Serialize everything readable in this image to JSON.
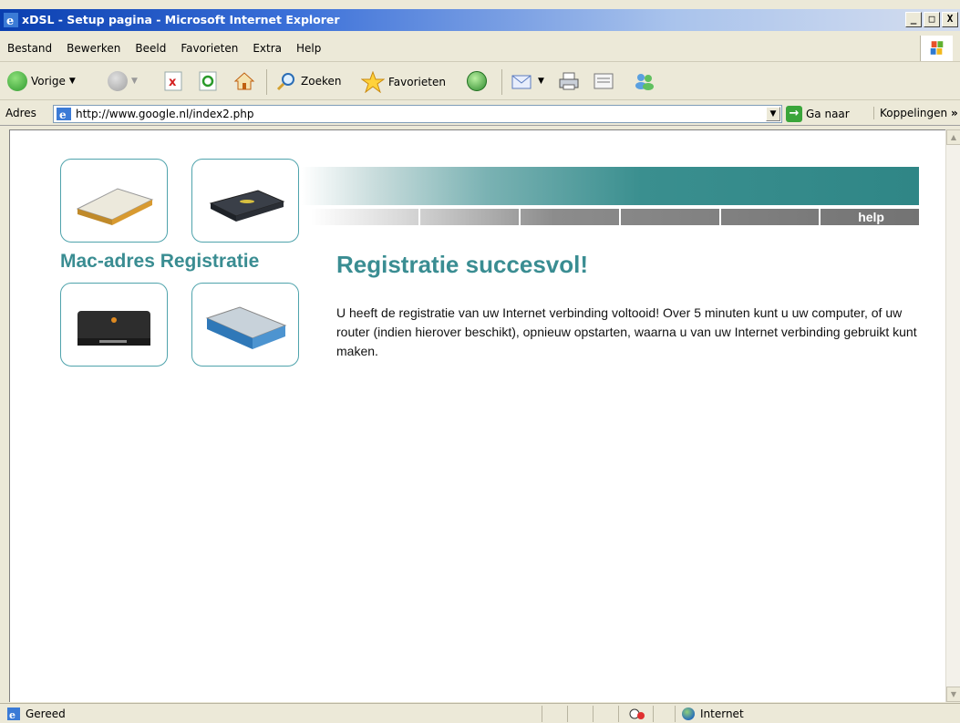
{
  "window": {
    "title": "xDSL - Setup pagina - Microsoft Internet Explorer",
    "buttons": {
      "minimize": "_",
      "maximize": "□",
      "close": "X"
    }
  },
  "menu": {
    "items": [
      "Bestand",
      "Bewerken",
      "Beeld",
      "Favorieten",
      "Extra",
      "Help"
    ]
  },
  "toolbar": {
    "back_label": "Vorige",
    "search_label": "Zoeken",
    "favorites_label": "Favorieten"
  },
  "address": {
    "label": "Adres",
    "url": "http://www.google.nl/index2.php",
    "go_label": "Ga naar",
    "links_label": "Koppelingen",
    "chevron": "»"
  },
  "page": {
    "brand": "Mac-adres Registratie",
    "nav_help": "help",
    "heading": "Registratie succesvol!",
    "body": "U heeft de registratie van uw Internet verbinding voltooid! Over 5 minuten kunt u uw computer, of uw router (indien hierover beschikt), opnieuw opstarten, waarna u van uw Internet verbinding gebruikt kunt maken."
  },
  "status": {
    "left_text": "Gereed",
    "zone_text": "Internet"
  }
}
